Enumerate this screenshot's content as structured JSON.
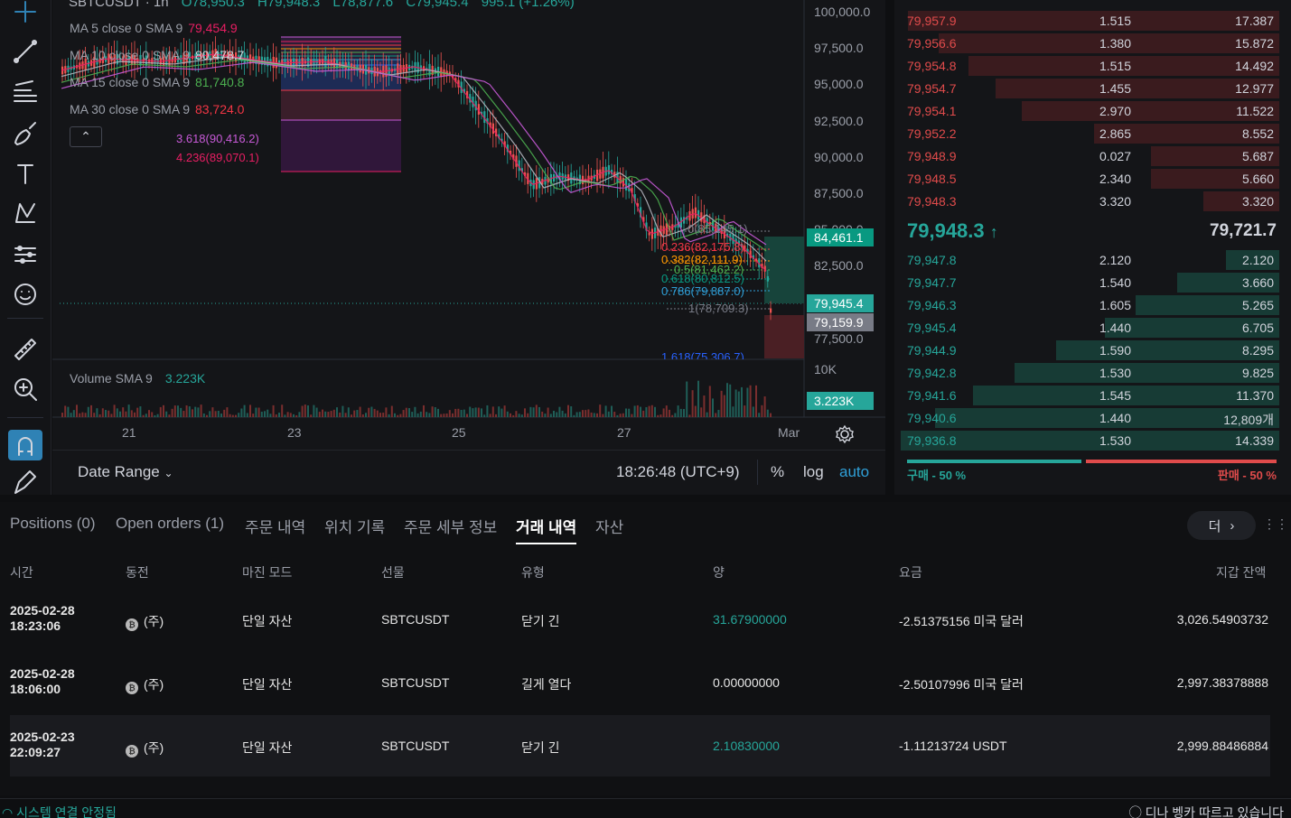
{
  "chart": {
    "symbol": "SBTCUSDT · 1h",
    "ohlc": {
      "o": "O78,950.3",
      "h": "H79,948.3",
      "l": "L78,877.6",
      "c": "C79,945.4",
      "chg": "995.1 (+1.26%)"
    },
    "ma": [
      {
        "label": "MA 5 close 0 SMA 9",
        "value": "79,454.9",
        "color": "#e91e63"
      },
      {
        "label": "MA 10 close 0 SMA 9",
        "value": "80,478.7",
        "color": "#b2b5be"
      },
      {
        "label": "MA 15 close 0 SMA 9",
        "value": "81,740.8",
        "color": "#4caf50"
      },
      {
        "label": "MA 30 close 0 SMA 9",
        "value": "83,724.0",
        "color": "#f23645"
      }
    ],
    "collapse_icon": "chevron-up-icon",
    "left_fib_labels": [
      {
        "text": "3.618(90,416.2)",
        "color": "#c85ad8"
      },
      {
        "text": "4.236(89,070.1)",
        "color": "#e91e63"
      }
    ],
    "right_fib_labels": [
      {
        "text": "0(85,145.1)",
        "color": "#787b86"
      },
      {
        "text": "0.236(82,175.8)",
        "color": "#f23645"
      },
      {
        "text": "0.382(82,111.9)",
        "color": "#ff9800"
      },
      {
        "text": "0.5(81,462.2)",
        "color": "#4caf50"
      },
      {
        "text": "0.618(80,812.5)",
        "color": "#089981"
      },
      {
        "text": "0.786(79,887.0)",
        "color": "#2f9fd7"
      },
      {
        "text": "1(78,709.3)",
        "color": "#787b86"
      },
      {
        "text": "1.618(75,306.7)",
        "color": "#2962ff"
      }
    ],
    "price_axis": [
      "100,000.0",
      "97,500.0",
      "95,000.0",
      "92,500.0",
      "90,000.0",
      "87,500.0",
      "85,000.0",
      "82,500.0",
      "77,500.0",
      "10K"
    ],
    "price_tags": [
      {
        "text": "84,461.1",
        "bg": "#089981"
      },
      {
        "text": "79,945.4",
        "bg": "#26a69a"
      },
      {
        "text": "79,159.9",
        "bg": "#787b86"
      },
      {
        "text": "3.223K",
        "bg": "#26a69a"
      }
    ],
    "time_axis": [
      "21",
      "23",
      "25",
      "27",
      "Mar"
    ],
    "volume": {
      "label": "Volume SMA 9",
      "value": "3.223K"
    },
    "date_range": "Date Range",
    "clock": "18:26:48 (UTC+9)",
    "pct": "%",
    "log": "log",
    "auto": "auto",
    "settings_icon": "gear-icon"
  },
  "toolbar": [
    "crosshair-icon",
    "trendline-icon",
    "fib-icon",
    "brush-icon",
    "text-icon",
    "pattern-icon",
    "forecast-icon",
    "emoji-icon",
    "ruler-icon",
    "zoom-in-icon",
    "magnet-icon",
    "pencil-lock-icon"
  ],
  "orderbook": {
    "asks": [
      {
        "price": "79,957.9",
        "qty": "1.515",
        "total": "17.387",
        "depth": 0.98
      },
      {
        "price": "79,956.6",
        "qty": "1.380",
        "total": "15.872",
        "depth": 0.9
      },
      {
        "price": "79,954.8",
        "qty": "1.515",
        "total": "14.492",
        "depth": 0.82
      },
      {
        "price": "79,954.7",
        "qty": "1.455",
        "total": "12.977",
        "depth": 0.75
      },
      {
        "price": "79,954.1",
        "qty": "2.970",
        "total": "11.522",
        "depth": 0.68
      },
      {
        "price": "79,952.2",
        "qty": "2.865",
        "total": "8.552",
        "depth": 0.49
      },
      {
        "price": "79,948.9",
        "qty": "0.027",
        "total": "5.687",
        "depth": 0.34
      },
      {
        "price": "79,948.5",
        "qty": "2.340",
        "total": "5.660",
        "depth": 0.34
      },
      {
        "price": "79,948.3",
        "qty": "3.320",
        "total": "3.320",
        "depth": 0.2
      }
    ],
    "mid_price": "79,948.3",
    "mid_arrow": "↑",
    "mid_ref": "79,721.7",
    "bids": [
      {
        "price": "79,947.8",
        "qty": "2.120",
        "total": "2.120",
        "depth": 0.14
      },
      {
        "price": "79,947.7",
        "qty": "1.540",
        "total": "3.660",
        "depth": 0.27
      },
      {
        "price": "79,946.3",
        "qty": "1.605",
        "total": "5.265",
        "depth": 0.38
      },
      {
        "price": "79,945.4",
        "qty": "1.440",
        "total": "6.705",
        "depth": 0.46
      },
      {
        "price": "79,944.9",
        "qty": "1.590",
        "total": "8.295",
        "depth": 0.59
      },
      {
        "price": "79,942.8",
        "qty": "1.530",
        "total": "9.825",
        "depth": 0.7
      },
      {
        "price": "79,941.6",
        "qty": "1.545",
        "total": "11.370",
        "depth": 0.81
      },
      {
        "price": "79,940.6",
        "qty": "1.440",
        "total": "12,809개",
        "depth": 0.91
      },
      {
        "price": "79,936.8",
        "qty": "1.530",
        "total": "14.339",
        "depth": 1.0
      }
    ],
    "buy_label": "구매 - 50 %",
    "sell_label": "판매 - 50 %"
  },
  "tabs": [
    "Positions (0)",
    "Open orders (1)",
    "주문 내역",
    "위치 기록",
    "주문 세부 정보",
    "거래 내역",
    "자산"
  ],
  "more_label": "더",
  "table": {
    "headers": [
      "시간",
      "동전",
      "마진 모드",
      "선물",
      "유형",
      "양",
      "요금",
      "지갑 잔액"
    ],
    "rows": [
      {
        "date": "2025-02-28",
        "time": "18:23:06",
        "coin": "(주)",
        "mode": "단일 자산",
        "symbol": "SBTCUSDT",
        "type": "닫기 긴",
        "qty": "31.67900000",
        "fee": "-2.51375156 미국 달러",
        "balance": "3,026.54903732"
      },
      {
        "date": "2025-02-28",
        "time": "18:06:00",
        "coin": "(주)",
        "mode": "단일 자산",
        "symbol": "SBTCUSDT",
        "type": "길게 열다",
        "qty": "0.00000000",
        "fee": "-2.50107996 미국 달러",
        "balance": "2,997.38378888"
      },
      {
        "date": "2025-02-23",
        "time": "22:09:27",
        "coin": "(주)",
        "mode": "단일 자산",
        "symbol": "SBTCUSDT",
        "type": "닫기 긴",
        "qty": "2.10830000",
        "fee": "-1.11213724 USDT",
        "balance": "2,999.88486884"
      }
    ]
  },
  "status": {
    "connection": "시스템 연결 안정됨",
    "right": "디나 벵카 따르고 있습니다"
  }
}
